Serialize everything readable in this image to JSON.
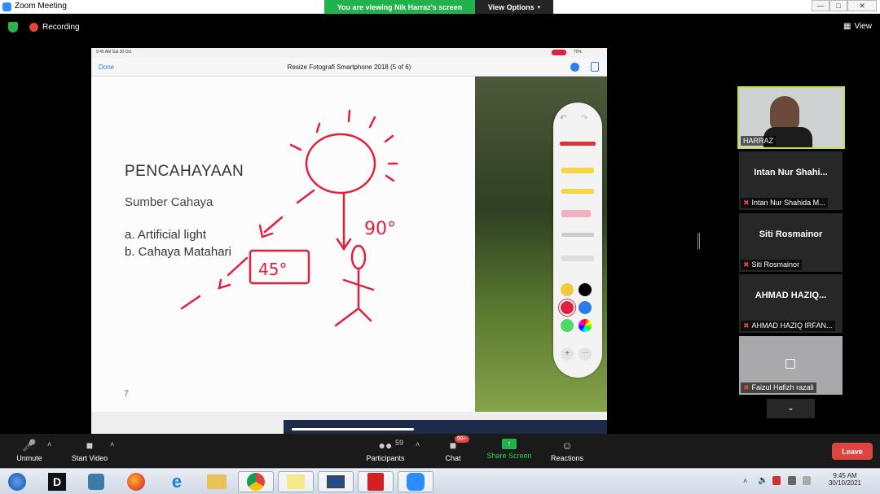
{
  "window": {
    "title": "Zoom Meeting",
    "viewing_banner": "You are viewing Nik Harraz's screen",
    "view_options": "View Options"
  },
  "topbar": {
    "recording": "Recording",
    "view": "View"
  },
  "ipad": {
    "status_time": "9:45 AM  Sat 30 Oct",
    "status_battery": "70%",
    "done": "Done",
    "doc_title": "Resize Fotografi Smartphone 2018 (5 of 6)"
  },
  "slide": {
    "title": "PENCAHAYAAN",
    "subtitle": "Sumber Cahaya",
    "item_a": "a. Artificial light",
    "item_b": "b. Cahaya Matahari",
    "page": "7",
    "angle_45": "45°",
    "angle_90": "90°"
  },
  "participants": [
    {
      "name": "HARRAZ"
    },
    {
      "name": "Intan Nur Shahi...",
      "label": "Intan Nur Shahida M..."
    },
    {
      "name": "Siti Rosmainor",
      "label": "Siti Rosmainor"
    },
    {
      "name": "AHMAD HAZIQ...",
      "label": "AHMAD HAZIQ IRFAN..."
    },
    {
      "label": "Faizul Hafizh razali"
    }
  ],
  "toolbar": {
    "unmute": "Unmute",
    "start_video": "Start Video",
    "participants": "Participants",
    "participants_count": "59",
    "chat": "Chat",
    "chat_badge": "99+",
    "share_screen": "Share Screen",
    "reactions": "Reactions",
    "leave": "Leave"
  },
  "taskbar": {
    "time": "9:45 AM",
    "date": "30/10/2021"
  },
  "colors": {
    "zoom_green": "#21b24b",
    "leave_red": "#e0443f",
    "active_border": "#c3e33a",
    "ink": "#e0203c"
  }
}
